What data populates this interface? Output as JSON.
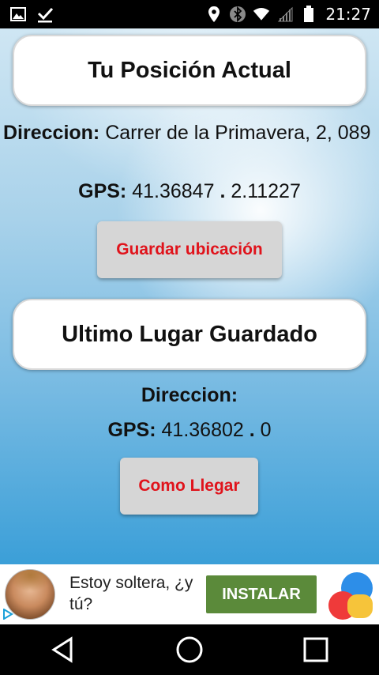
{
  "status_bar": {
    "time": "21:27",
    "left_icons": [
      "image-icon",
      "download-done-icon"
    ],
    "right_icons": [
      "location-icon",
      "bluetooth-icon",
      "wifi-icon",
      "signal-icon",
      "battery-icon"
    ]
  },
  "current_position": {
    "title": "Tu Posición Actual",
    "address_label": "Direccion:",
    "address_value": "Carrer de la Primavera, 2, 089",
    "gps_label": "GPS:",
    "gps_lat": "41.36847",
    "gps_separator": ".",
    "gps_lon": "2.11227",
    "save_button": "Guardar ubicación"
  },
  "saved_place": {
    "title": "Ultimo Lugar Guardado",
    "address_label": "Direccion:",
    "gps_label": "GPS:",
    "gps_lat": "41.36802",
    "gps_separator": ".",
    "gps_lon": "0",
    "directions_button": "Como Llegar"
  },
  "ad": {
    "text": "Estoy soltera, ¿y tú?",
    "install_button": "INSTALAR",
    "colors": {
      "install_bg": "#5b8a3a"
    }
  },
  "nav_bar": {
    "buttons": [
      "back-icon",
      "home-icon",
      "recents-icon"
    ]
  },
  "colors": {
    "button_text": "#e0131b",
    "button_bg": "#d6d6d6"
  }
}
